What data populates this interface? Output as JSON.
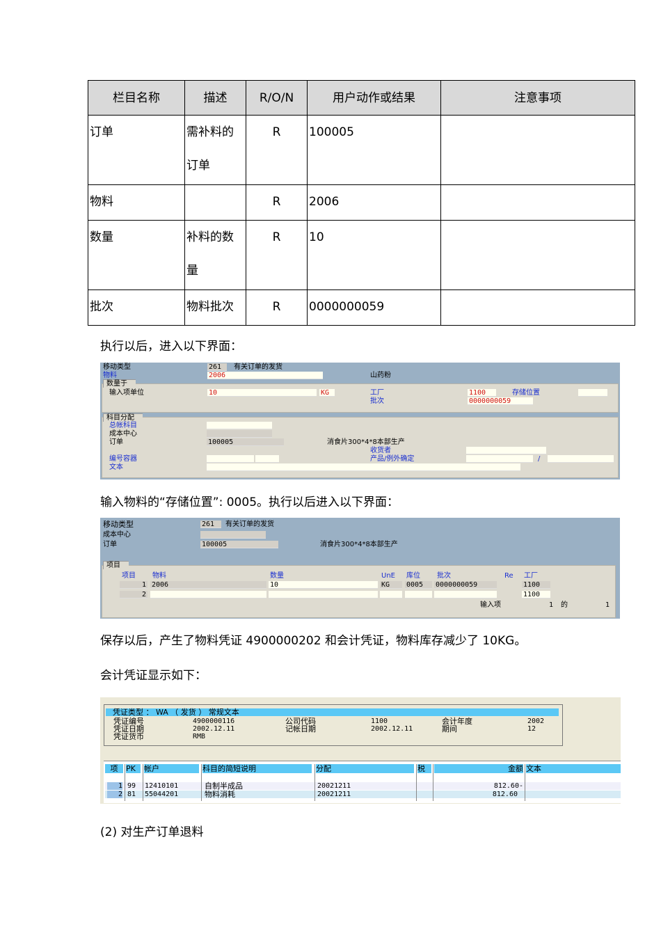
{
  "table": {
    "headers": [
      "栏目名称",
      "描述",
      "R/O/N",
      "用户动作或结果",
      "注意事项"
    ],
    "rows": [
      {
        "field": "订单",
        "desc": "需补料的订单",
        "ron": "R",
        "value": "100005",
        "note": ""
      },
      {
        "field": "物料",
        "desc": "",
        "ron": "R",
        "value": "2006",
        "note": ""
      },
      {
        "field": "数量",
        "desc": "补料的数量",
        "ron": "R",
        "value": "10",
        "note": ""
      },
      {
        "field": "批次",
        "desc": "物料批次",
        "ron": "R",
        "value": "0000000059",
        "note": ""
      }
    ]
  },
  "para1": "执行以后，进入以下界面：",
  "screen1": {
    "movement_type_label": "移动类型",
    "movement_type": "261",
    "movement_type_text": "有关订单的发货",
    "material_label": "物料",
    "material": "2006",
    "material_text": "山药粉",
    "qty_tab": "数量于",
    "unit_label": "输入项单位",
    "qty": "10",
    "unit": "KG",
    "plant_label": "工厂",
    "plant": "1100",
    "storage_label": "存储位置",
    "storage": "",
    "batch_label": "批次",
    "batch": "0000000059",
    "acct_tab": "科目分配",
    "gl_label": "总帐科目",
    "cc_label": "成本中心",
    "order_label": "订单",
    "order": "100005",
    "order_text": "消食片300*4*8本部生产",
    "recipient_label": "收货者",
    "container_label": "编号容器",
    "product_label": "产品/例外确定",
    "slash": "/",
    "text_label": "文本"
  },
  "para2": "输入物料的“存储位置”: 0005。执行以后进入以下界面：",
  "screen2": {
    "movement_type_label": "移动类型",
    "movement_type": "261",
    "movement_type_text": "有关订单的发货",
    "cc_label": "成本中心",
    "order_label": "订单",
    "order": "100005",
    "order_text": "消食片300*4*8本部生产",
    "items_tab": "项目",
    "columns": [
      "项目",
      "物料",
      "数量",
      "UnE",
      "库位",
      "批次",
      "Re",
      "工厂"
    ],
    "rows": [
      {
        "item": "1",
        "material": "2006",
        "qty": "10",
        "unit": "KG",
        "sloc": "0005",
        "batch": "0000000059",
        "plant": "1100"
      },
      {
        "item": "2",
        "material": "",
        "qty": "",
        "unit": "",
        "sloc": "",
        "batch": "",
        "plant": "1100"
      }
    ],
    "entry_label": "输入项",
    "entry_num": "1",
    "of_label": "的",
    "entry_total": "1"
  },
  "para3": "保存以后，产生了物料凭证 4900000202 和会计凭证，物料库存减少了 10KG。",
  "para4": "会计凭证显示如下：",
  "screen3": {
    "doc_type": "凭证类型 ： WA （ 发货 ） 常规文本",
    "doc_no_label": "凭证编号",
    "doc_no": "4900000116",
    "company_label": "公司代码",
    "company": "1100",
    "year_label": "会计年度",
    "year": "2002",
    "doc_date_label": "凭证日期",
    "doc_date": "2002.12.11",
    "post_date_label": "记帐日期",
    "post_date": "2002.12.11",
    "period_label": "期间",
    "period": "12",
    "currency_label": "凭证货币",
    "currency": "RMB",
    "columns": [
      "项",
      "PK",
      "帐户",
      "科目的简短说明",
      "分配",
      "税",
      "金额",
      "文本"
    ],
    "rows": [
      {
        "item": "1",
        "pk": "99",
        "account": "12410101",
        "desc": "自制半成品",
        "assign": "20021211",
        "amount": "812.60-"
      },
      {
        "item": "2",
        "pk": "81",
        "account": "55044201",
        "desc": "物料消耗",
        "assign": "20021211",
        "amount": "812.60"
      }
    ]
  },
  "para5": "(2) 对生产订单退料"
}
